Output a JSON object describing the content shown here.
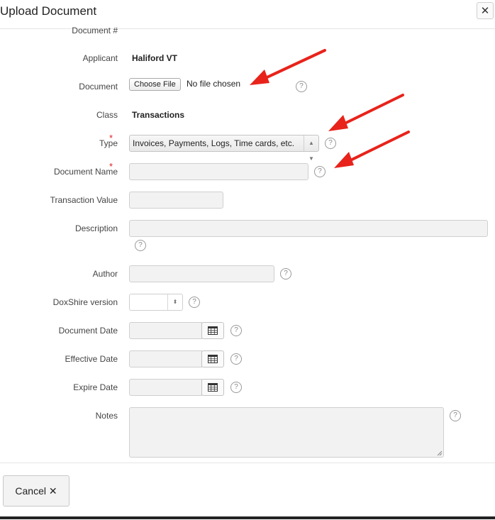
{
  "dialog": {
    "title": "Upload Document",
    "close_symbol": "✕"
  },
  "form": {
    "document_number_label": "Document #",
    "applicant_label": "Applicant",
    "applicant_value": "Haliford VT",
    "document_label": "Document",
    "choose_file_label": "Choose File",
    "file_status": "No file chosen",
    "class_label": "Class",
    "class_value": "Transactions",
    "type_label": "Type",
    "type_value": "Invoices, Payments, Logs, Time cards, etc.",
    "document_name_label": "Document Name",
    "transaction_value_label": "Transaction Value",
    "description_label": "Description",
    "author_label": "Author",
    "doxshire_version_label": "DoxShire version",
    "document_date_label": "Document Date",
    "effective_date_label": "Effective Date",
    "expire_date_label": "Expire Date",
    "notes_label": "Notes",
    "required_marker": "*",
    "help_symbol": "?"
  },
  "footer": {
    "cancel_label": "Cancel ✕"
  },
  "colors": {
    "annotation_arrow": "#e8231b",
    "required_marker": "#e02020"
  }
}
